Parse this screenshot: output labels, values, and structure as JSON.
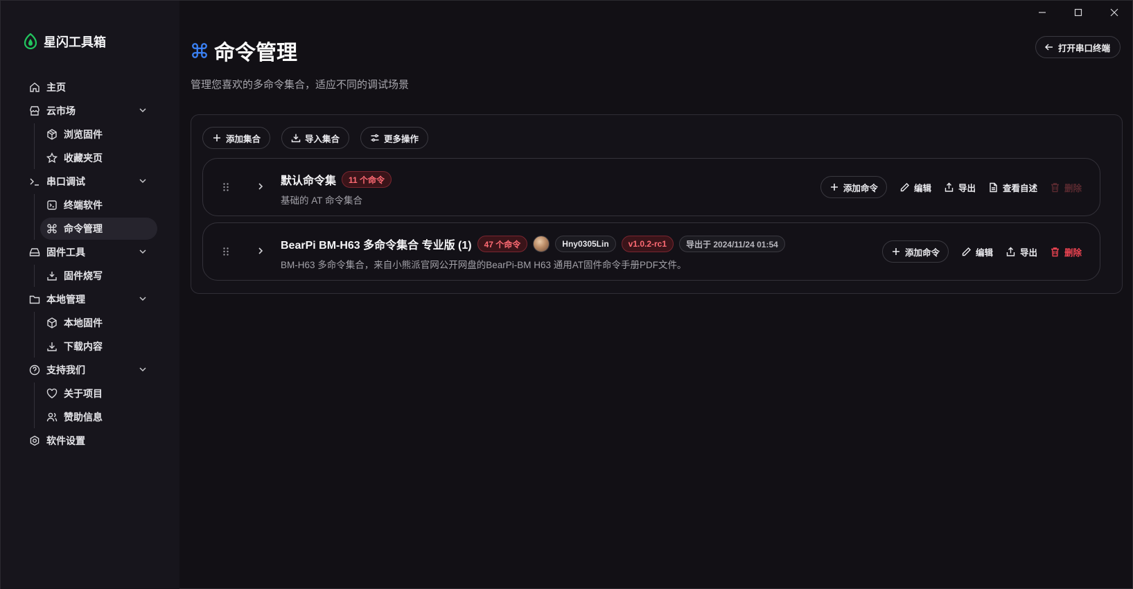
{
  "app": {
    "name": "星闪工具箱"
  },
  "window_controls": {
    "minimize": "minimize-icon",
    "maximize": "maximize-icon",
    "close": "close-icon"
  },
  "sidebar": {
    "items": [
      {
        "label": "主页",
        "icon": "home-icon"
      },
      {
        "label": "云市场",
        "icon": "store-icon",
        "children": [
          {
            "label": "浏览固件",
            "icon": "package-icon"
          },
          {
            "label": "收藏夹页",
            "icon": "star-icon"
          }
        ]
      },
      {
        "label": "串口调试",
        "icon": "terminal-icon",
        "children": [
          {
            "label": "终端软件",
            "icon": "terminal-square-icon"
          },
          {
            "label": "命令管理",
            "icon": "command-icon",
            "active": true
          }
        ]
      },
      {
        "label": "固件工具",
        "icon": "hard-drive-icon",
        "children": [
          {
            "label": "固件烧写",
            "icon": "download-tray-icon"
          }
        ]
      },
      {
        "label": "本地管理",
        "icon": "folder-icon",
        "children": [
          {
            "label": "本地固件",
            "icon": "box-icon"
          },
          {
            "label": "下载内容",
            "icon": "download-icon"
          }
        ]
      },
      {
        "label": "支持我们",
        "icon": "help-circle-icon",
        "children": [
          {
            "label": "关于项目",
            "icon": "heart-icon"
          },
          {
            "label": "赞助信息",
            "icon": "users-icon"
          }
        ]
      },
      {
        "label": "软件设置",
        "icon": "settings-icon"
      }
    ]
  },
  "header": {
    "title": "命令管理",
    "subtitle": "管理您喜欢的多命令集合，适应不同的调试场景",
    "open_terminal": "打开串口终端"
  },
  "toolbar": {
    "add_collection": "添加集合",
    "import_collection": "导入集合",
    "more_actions": "更多操作"
  },
  "collections": [
    {
      "name": "默认命令集",
      "count_badge": "11 个命令",
      "description": "基础的 AT 命令集合",
      "actions": {
        "add": "添加命令",
        "edit": "编辑",
        "export": "导出",
        "readme": "查看自述",
        "delete": "删除"
      },
      "delete_disabled": true
    },
    {
      "name": "BearPi BM-H63 多命令集合 专业版 (1)",
      "count_badge": "47 个命令",
      "author": "Hny0305Lin",
      "version": "v1.0.2-rc1",
      "exported_at": "导出于 2024/11/24 01:54",
      "description": "BM-H63 多命令集合，来自小熊派官网公开网盘的BearPi-BM H63 通用AT固件命令手册PDF文件。",
      "actions": {
        "add": "添加命令",
        "edit": "编辑",
        "export": "导出",
        "delete": "删除"
      },
      "delete_disabled": false
    }
  ],
  "colors": {
    "accent": "#22c55e",
    "header_icon": "#3b82f6",
    "danger": "#ef4452",
    "badge_red": "#ff6b74"
  }
}
